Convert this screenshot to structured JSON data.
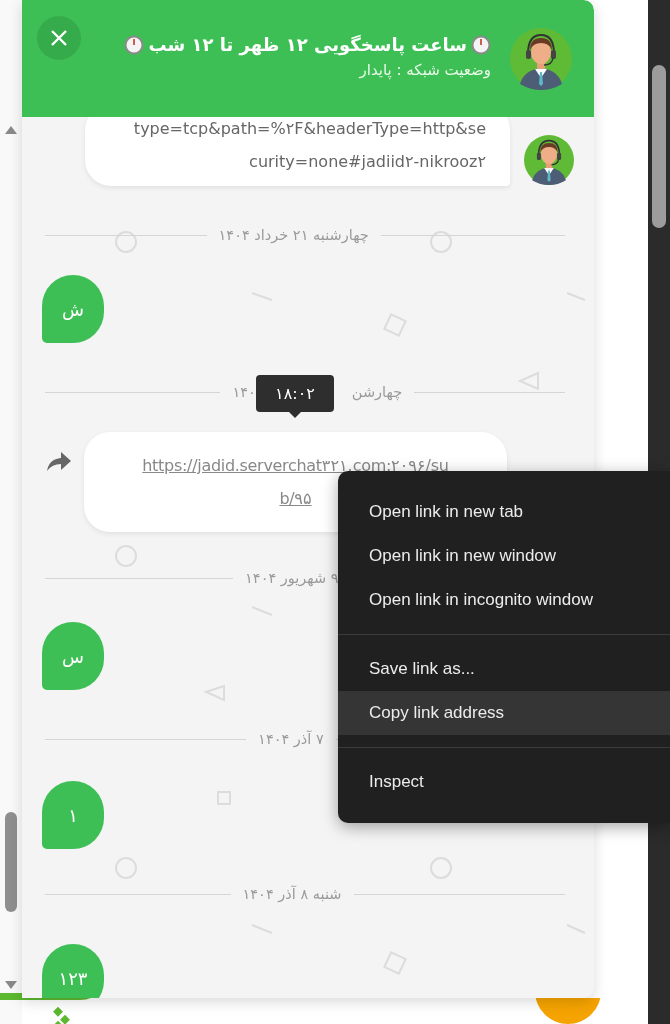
{
  "header": {
    "title": "ساعت پاسخگویی ۱۲ ظهر تا ۱۲ شب",
    "subtitle": "وضعیت شبکه : پایدار"
  },
  "messages": [
    {
      "kind": "agent",
      "lines": [
        "type=tcp&path=%۲F&headerType=http&se",
        "curity=none#jadiid۲-nikrooz۲"
      ]
    },
    {
      "kind": "date",
      "label": "چهارشنبه ۲۱ خرداد ۱۴۰۴"
    },
    {
      "kind": "user",
      "text": "ش"
    },
    {
      "kind": "date",
      "label_parts": [
        "چهارشن",
        "۱۴۰"
      ]
    },
    {
      "kind": "link",
      "lines": [
        "https://jadid.serverchat۳۲۱.com:۲۰۹۶/su",
        "b/۹۵"
      ],
      "time": "۱۸:۰۲"
    },
    {
      "kind": "date",
      "label": "۹ شهریور ۱۴۰۴"
    },
    {
      "kind": "user",
      "text": "س"
    },
    {
      "kind": "date",
      "label": "۷ آذر ۱۴۰۴"
    },
    {
      "kind": "user",
      "text": "۱"
    },
    {
      "kind": "date",
      "label": "شنبه ۸ آذر ۱۴۰۴"
    },
    {
      "kind": "user",
      "text": "۱۲۳"
    }
  ],
  "context_menu": {
    "groups": [
      [
        {
          "label": "Open link in new tab",
          "selected": false
        },
        {
          "label": "Open link in new window",
          "selected": false
        },
        {
          "label": "Open link in incognito window",
          "selected": false
        }
      ],
      [
        {
          "label": "Save link as...",
          "selected": false
        },
        {
          "label": "Copy link address",
          "selected": true
        }
      ],
      [
        {
          "label": "Inspect",
          "selected": false
        }
      ]
    ]
  }
}
